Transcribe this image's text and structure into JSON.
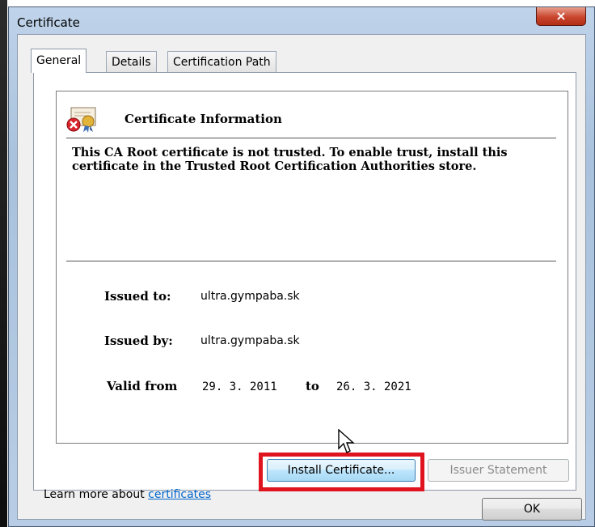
{
  "window": {
    "title": "Certificate",
    "close_glyph": "×"
  },
  "tabs": [
    {
      "label": "General",
      "active": true
    },
    {
      "label": "Details",
      "active": false
    },
    {
      "label": "Certification Path",
      "active": false
    }
  ],
  "certificate": {
    "icon": "certificate-error-icon",
    "heading": "Certificate Information",
    "message": "This CA Root certificate is not trusted. To enable trust, install this certificate in the Trusted Root Certification Authorities store.",
    "issued_to_label": "Issued to:",
    "issued_to": "ultra.gympaba.sk",
    "issued_by_label": "Issued by:",
    "issued_by": "ultra.gympaba.sk",
    "valid_from_label": "Valid from",
    "valid_from": "29. 3. 2011",
    "to_label": "to",
    "valid_to": "26. 3. 2021"
  },
  "buttons": {
    "install": "Install Certificate...",
    "issuer_statement": "Issuer Statement",
    "ok": "OK"
  },
  "learn_more": {
    "prefix": "Learn more about ",
    "link": "certificates"
  },
  "colors": {
    "highlight": "#e0141e",
    "link": "#0066cc"
  }
}
